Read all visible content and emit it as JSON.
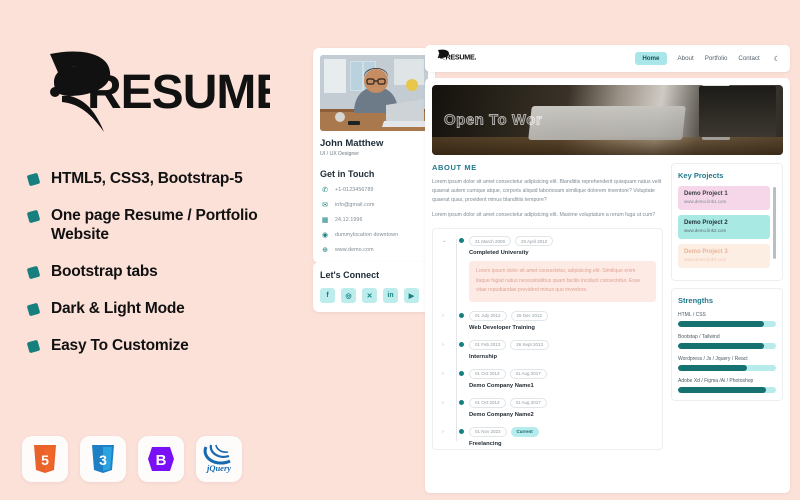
{
  "promo": {
    "logo_text": "RESUME.",
    "features": [
      "HTML5, CSS3, Bootstrap-5",
      "One page Resume / Portfolio Website",
      "Bootstrap tabs",
      "Dark & Light Mode",
      "Easy To Customize"
    ],
    "tech_badges": [
      {
        "name": "html5-icon",
        "label": "5"
      },
      {
        "name": "css3-icon",
        "label": "3"
      },
      {
        "name": "bootstrap-icon",
        "label": "B"
      },
      {
        "name": "jquery-icon",
        "label": "jQuery"
      }
    ],
    "colors": {
      "background": "#fce1d9",
      "bullet": "#17807f",
      "heading": "#111111"
    }
  },
  "navbar": {
    "brand": "RESUME.",
    "links": [
      {
        "label": "Home",
        "active": true
      },
      {
        "label": "About",
        "active": false
      },
      {
        "label": "Portfolio",
        "active": false
      },
      {
        "label": "Contact",
        "active": false
      }
    ],
    "theme_toggle_icon": "moon-icon",
    "theme_toggle_glyph": "☾",
    "active_color": "#a8e6ea"
  },
  "profile": {
    "name": "John Matthew",
    "role": "UI / UX Designer",
    "contact_heading": "Get in Touch",
    "contacts": [
      {
        "icon": "phone-icon",
        "glyph": "✆",
        "value": "+1-0123456789"
      },
      {
        "icon": "email-icon",
        "glyph": "✉",
        "value": "info@gmail.com"
      },
      {
        "icon": "calendar-icon",
        "glyph": "▦",
        "value": "24.12.1996"
      },
      {
        "icon": "location-icon",
        "glyph": "◉",
        "value": "dummylocation downtown"
      },
      {
        "icon": "globe-icon",
        "glyph": "⊕",
        "value": "www.demo.com"
      }
    ],
    "connect_heading": "Let's Connect",
    "socials": [
      {
        "icon": "facebook-icon",
        "glyph": "f"
      },
      {
        "icon": "instagram-icon",
        "glyph": "◎"
      },
      {
        "icon": "x-twitter-icon",
        "glyph": "✕"
      },
      {
        "icon": "linkedin-icon",
        "glyph": "in"
      },
      {
        "icon": "youtube-icon",
        "glyph": "▶"
      }
    ]
  },
  "hero": {
    "headline": "Open To Wor"
  },
  "about": {
    "heading": "ABOUT ME",
    "paragraph1": "Lorem ipsum dolor sit amet consectetur adipisicing elit. Blanditiis reprehenderit quisquam natus velit quaerat autem cumque atque, corporis aliquid laboriosam similique dolorem inventore? Voluptate quaerat quas, provident minus blanditiis tempore?",
    "paragraph2": "Lorem ipsum dolor sit amet consectetur adipisicing elit. Maxime voluptatum a rerum fuga ut cum?"
  },
  "timeline": [
    {
      "start": "31 March 2009",
      "end": "25 April 2012",
      "current": false,
      "title": "Completed University",
      "expanded": true,
      "caret": "⌄",
      "body": "Lorem ipsum dolor sit amet consectetur, adipisicing elit. Similique enim itaque fugiat natus necessitatibus quam facilis incidunt consectetur. Esse vitae repudiandae provident minus quo inventore."
    },
    {
      "start": "01 July 2012",
      "end": "25 Dec 2012",
      "current": false,
      "title": "Web Developer Training",
      "expanded": false,
      "caret": "›",
      "body": ""
    },
    {
      "start": "01 Feb 2013",
      "end": "26 Sept 2013",
      "current": false,
      "title": "Internship",
      "expanded": false,
      "caret": "›",
      "body": ""
    },
    {
      "start": "01 Oct 2013",
      "end": "31 Aug 2017",
      "current": false,
      "title": "Demo Company Name1",
      "expanded": false,
      "caret": "›",
      "body": ""
    },
    {
      "start": "01 Oct 2013",
      "end": "31 Aug 2017",
      "current": false,
      "title": "Demo Company Name2",
      "expanded": false,
      "caret": "›",
      "body": ""
    },
    {
      "start": "01 Nov 2023",
      "end": "Current",
      "current": true,
      "title": "Freelancing",
      "expanded": false,
      "caret": "›",
      "body": ""
    }
  ],
  "projects": {
    "heading": "Key Projects",
    "items": [
      {
        "title": "Demo Project 1",
        "url": "www.demo.link1.com",
        "color": "#f6d7ea"
      },
      {
        "title": "Demo Project 2",
        "url": "www.demo.link2.com",
        "color": "#a8eae3"
      },
      {
        "title": "Demo Project 3",
        "url": "www.demo.link3.com",
        "color": "#fdeee4"
      }
    ]
  },
  "strengths": {
    "heading": "Strengths",
    "items": [
      {
        "label": "HTML / CSS",
        "percent": 88
      },
      {
        "label": "Bootstap / Tailwind",
        "percent": 88
      },
      {
        "label": "Wordpress / Js / Jquery / React",
        "percent": 70
      },
      {
        "label": "Adobe Xd / Figma /Ai / Photoshop",
        "percent": 90
      }
    ],
    "track_color": "#b8ecec",
    "fill_color": "#167171"
  }
}
